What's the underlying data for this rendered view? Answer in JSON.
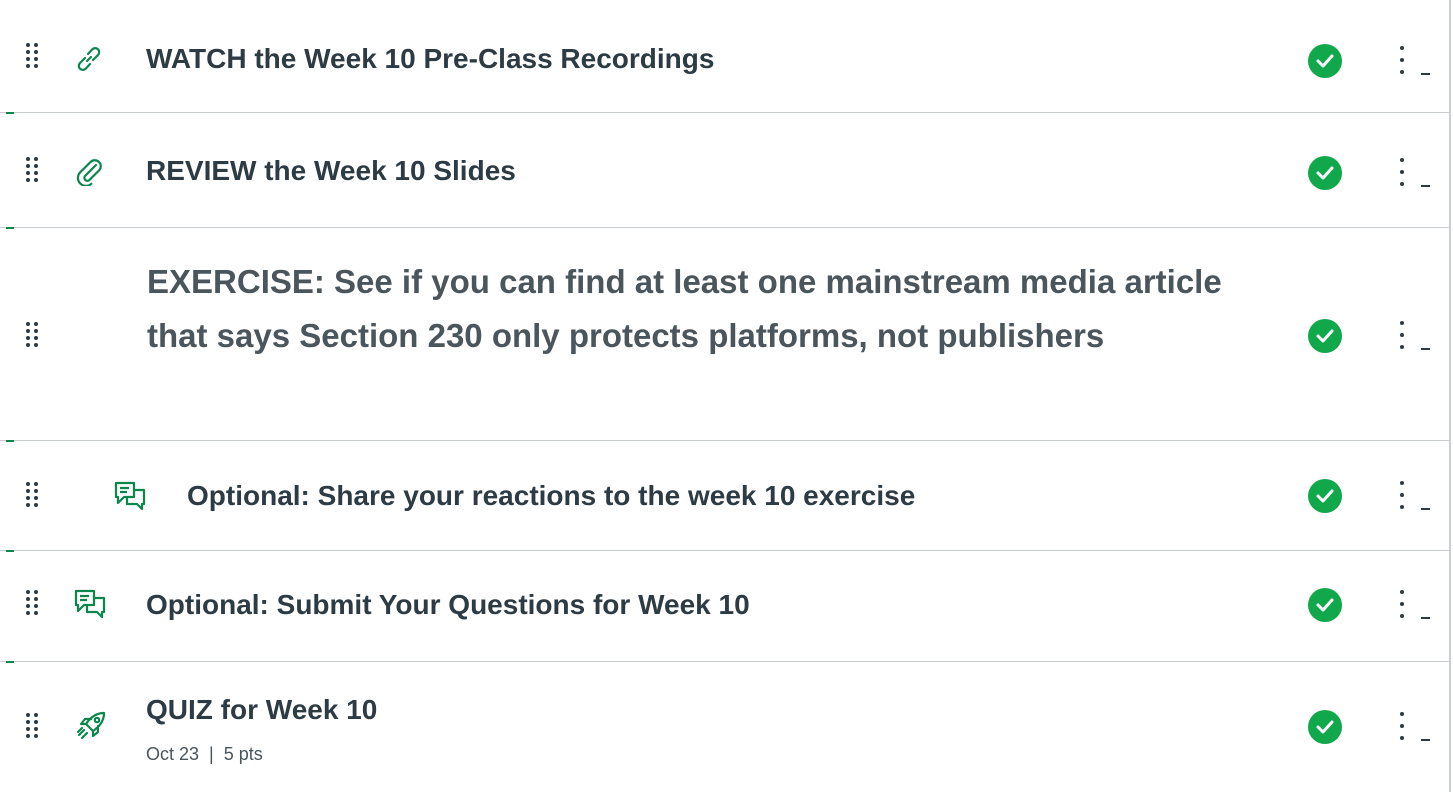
{
  "module_items": [
    {
      "title": "WATCH the Week 10 Pre-Class Recordings",
      "type_icon": "link-icon",
      "status": "completed-check-icon"
    },
    {
      "title": "REVIEW the Week 10 Slides",
      "type_icon": "paperclip-icon",
      "status": "completed-check-icon"
    },
    {
      "title": "EXERCISE: See if you can find at least one mainstream media article that says Section 230 only protects platforms, not publishers",
      "type_icon": "",
      "status": "completed-check-icon"
    },
    {
      "title": "Optional: Share your reactions to the week 10 exercise",
      "type_icon": "discussion-icon",
      "status": "completed-check-icon"
    },
    {
      "title": "Optional: Submit Your Questions for Week 10",
      "type_icon": "discussion-icon",
      "status": "completed-check-icon"
    },
    {
      "title": "QUIZ for Week 10",
      "type_icon": "rocket-icon",
      "status": "completed-check-icon",
      "due_date": "Oct 23",
      "separator": "|",
      "points": "5 pts"
    }
  ],
  "colors": {
    "accent_green": "#0b874b",
    "check_green": "#11a84b",
    "text": "#2d3b45",
    "divider": "#c7cdd1"
  }
}
